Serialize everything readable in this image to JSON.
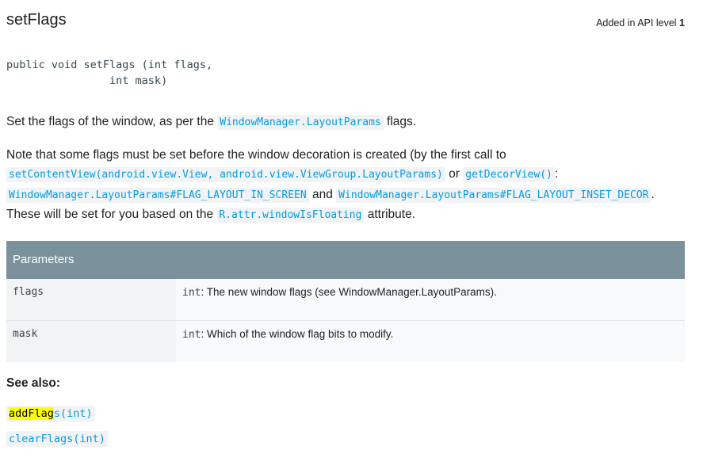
{
  "method": {
    "title": "setFlags",
    "api_level_prefix": "Added in API level",
    "api_level_value": "1",
    "signature_line1": "public void setFlags (int flags,",
    "signature_line2": "                int mask)"
  },
  "description": {
    "p1_text1": "Set the flags of the window, as per the ",
    "p1_link": "WindowManager.LayoutParams",
    "p1_text2": " flags.",
    "p2_text1": "Note that some flags must be set before the window decoration is created (by the first call to ",
    "p2_link1": "setContentView(android.view.View, android.view.ViewGroup.LayoutParams)",
    "p2_text2": " or ",
    "p2_link2": "getDecorView()",
    "p2_text3": ": ",
    "p2_link3": "WindowManager.LayoutParams#FLAG_LAYOUT_IN_SCREEN",
    "p2_text4": " and ",
    "p2_link4": "WindowManager.LayoutParams#FLAG_LAYOUT_INSET_DECOR",
    "p2_text5": ". These will be set for you based on the ",
    "p2_link5": "R.attr.windowIsFloating",
    "p2_text6": " attribute."
  },
  "parameters": {
    "header": "Parameters",
    "rows": [
      {
        "name": "flags",
        "type": "int",
        "desc": ": The new window flags (see WindowManager.LayoutParams)."
      },
      {
        "name": "mask",
        "type": "int",
        "desc": ": Which of the window flag bits to modify."
      }
    ]
  },
  "see_also": {
    "heading": "See also:",
    "links": [
      {
        "highlight": "addFlag",
        "rest": "s(int)"
      },
      {
        "highlight": "",
        "rest": "clearFlags(int)"
      }
    ],
    "highlight_color": "#ffff00"
  },
  "colors": {
    "link": "#039be5",
    "table_header": "#7b919c",
    "code_bg": "#f1f3f4"
  }
}
